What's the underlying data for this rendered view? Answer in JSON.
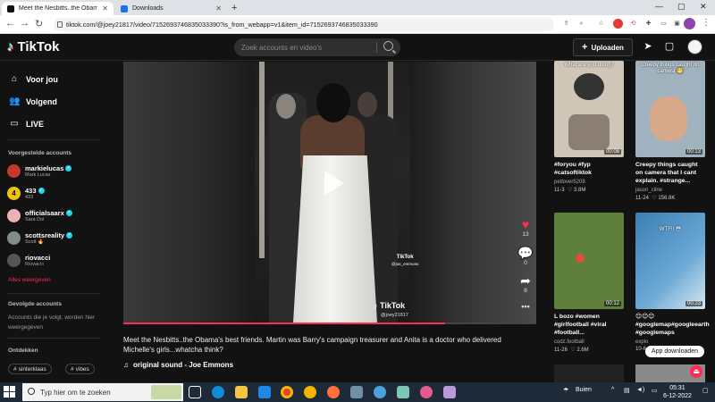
{
  "browser": {
    "tabs": [
      {
        "title": "Meet the Nesbitts..the Obama's b",
        "active": true
      },
      {
        "title": "Downloads",
        "active": false
      }
    ],
    "url": "tiktok.com/@joey21817/video/7152693746835033390?is_from_webapp=v1&item_id=7152693746835033390",
    "new_tab": "+",
    "minimize": "—",
    "maximize": "▢",
    "close": "✕"
  },
  "header": {
    "logo_text": "TikTok",
    "search_placeholder": "Zoek accounts en video's",
    "upload_label": "Uploaden"
  },
  "sidebar": {
    "nav": [
      {
        "label": "Voor jou",
        "icon": "home-icon"
      },
      {
        "label": "Volgend",
        "icon": "following-icon"
      },
      {
        "label": "LIVE",
        "icon": "live-icon"
      }
    ],
    "suggested_title": "Voorgestelde accounts",
    "accounts": [
      {
        "name": "markielucas",
        "sub": "Mark Lucas",
        "verified": true,
        "color": "#c0392b"
      },
      {
        "name": "433",
        "sub": "433",
        "verified": true,
        "color": "#f1c40f"
      },
      {
        "name": "officialsaarx",
        "sub": "Sara Dol",
        "verified": true,
        "color": "#e8b4b8"
      },
      {
        "name": "scottsreality",
        "sub": "Scott 🔥",
        "verified": true,
        "color": "#7f8c8d"
      },
      {
        "name": "riovacci",
        "sub": "Riovacci",
        "verified": false,
        "color": "#555555"
      }
    ],
    "see_all": "Alles weergeven",
    "followed_title": "Gevolgde accounts",
    "followed_text": "Accounts die je volgt, worden hier weergegeven",
    "discover_title": "Ontdekken",
    "tags": [
      "sinterklaas",
      "vibes"
    ]
  },
  "video": {
    "watermark_small": "TikTok",
    "watermark_small_user": "@joe_emmons",
    "watermark_big": "TikTok",
    "watermark_user": "@joey21817",
    "progress": 0.78
  },
  "actions": {
    "likes": "13",
    "comments": "0",
    "shares": "8",
    "more": "•••"
  },
  "caption": "Meet the Nesbitts..the Obama's best friends. Martin was Barry's campaign treasurer and Anita is a doctor who delivered Michelle's girls...whatcha think?",
  "sound": "original sound - Joe Emmons",
  "related": [
    {
      "thumb_caption": "What are you doing?",
      "duration": "00:08",
      "title": "#foryou #fyp #catsoftiktok",
      "author": "petlover5208",
      "date": "11-3",
      "likes": "3.8M",
      "bg": "#cfc6b8"
    },
    {
      "thumb_caption": "Creepy things caught on camera 😬",
      "duration": "00:13",
      "title": "Creepy things caught on camera that I cant explain. #strange...",
      "author": "jason_cline",
      "date": "11-24",
      "likes": "156.8K",
      "bg": "#9fb2bd"
    },
    {
      "thumb_caption": "",
      "duration": "00:12",
      "title": "L bozo #women #girlfootball #viral #football...",
      "author": "codz.football",
      "date": "11-26",
      "likes": "2.6M",
      "bg": "#5f7f3c"
    },
    {
      "thumb_caption": "WTF!! 😳",
      "duration": "00:23",
      "title": "😊😊😊 #googlemap#googleearth #googlemaps",
      "author": "explo",
      "date": "10-6",
      "likes": "",
      "bg": "#3d7fb4"
    }
  ],
  "download_label": "App downloaden",
  "taskbar": {
    "search_placeholder": "Typ hier om te zoeken",
    "weather": "Buien",
    "time": "05:31",
    "date": "6-12-2022"
  }
}
